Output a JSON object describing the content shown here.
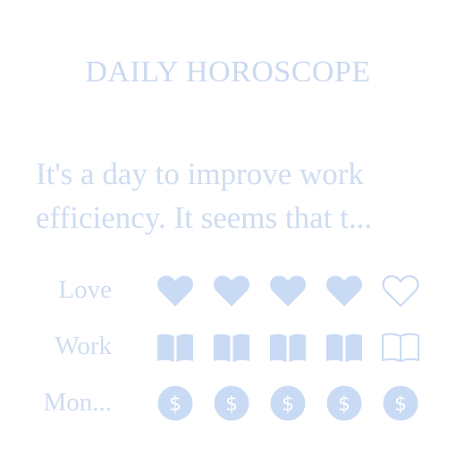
{
  "title": "DAILY HOROSCOPE",
  "description": {
    "line1": "It's a day to improve work",
    "line2": "efficiency. It seems that t..."
  },
  "ratings": [
    {
      "label": "Love",
      "icon": "heart-icon",
      "value": 4,
      "max": 5
    },
    {
      "label": "Work",
      "icon": "book-icon",
      "value": 4,
      "max": 5
    },
    {
      "label": "Mon...",
      "icon": "dollar-coin-icon",
      "value": 5,
      "max": 5
    }
  ],
  "colors": {
    "accent": "#c9daf4",
    "text": "#cfdcf1"
  }
}
